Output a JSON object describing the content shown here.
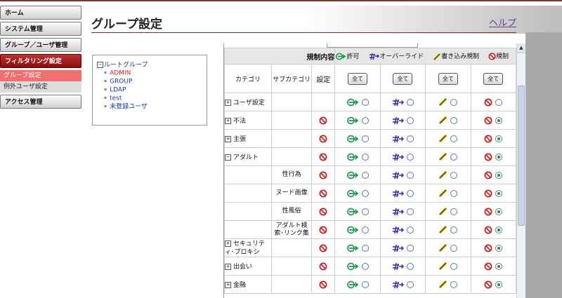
{
  "sidebar": {
    "home": "ホーム",
    "system": "システム管理",
    "group_user": "グループ／ユーザ管理",
    "filtering": "フィルタリング設定",
    "group_settings": "グループ設定",
    "exception_users": "例外ユーザ設定",
    "access": "アクセス管理"
  },
  "header": {
    "title": "グループ設定",
    "help": "ヘルプ"
  },
  "tree": {
    "root": "ルートグループ",
    "items": [
      "ADMIN",
      "GROUP",
      "LDAP",
      "test",
      "未登録ユーザ"
    ]
  },
  "legend": {
    "label": "規制内容",
    "allow": "許可",
    "override": "オーバーライド",
    "write": "書き込み規制",
    "block": "規制"
  },
  "columns": {
    "category": "カテゴリ",
    "subcategory": "サブカテゴリ",
    "setting": "設定",
    "all": "全て"
  },
  "rows": [
    {
      "cat": "ユーザ設定",
      "sub": "",
      "expand": "+",
      "block_icon": false,
      "selected": "none"
    },
    {
      "cat": "不法",
      "sub": "",
      "expand": "+",
      "block_icon": true,
      "selected": "block"
    },
    {
      "cat": "主張",
      "sub": "",
      "expand": "+",
      "block_icon": true,
      "selected": "block"
    },
    {
      "cat": "アダルト",
      "sub": "",
      "expand": "−",
      "block_icon": true,
      "selected": "block"
    },
    {
      "cat": "",
      "sub": "性行為",
      "expand": "",
      "block_icon": true,
      "selected": "block"
    },
    {
      "cat": "",
      "sub": "ヌード画像",
      "expand": "",
      "block_icon": true,
      "selected": "block"
    },
    {
      "cat": "",
      "sub": "性風俗",
      "expand": "",
      "block_icon": true,
      "selected": "block"
    },
    {
      "cat": "",
      "sub": "アダルト検索･リンク集",
      "expand": "",
      "block_icon": true,
      "selected": "block"
    },
    {
      "cat": "セキュリティ･プロキシ",
      "sub": "",
      "expand": "+",
      "block_icon": true,
      "selected": "block"
    },
    {
      "cat": "出会い",
      "sub": "",
      "expand": "+",
      "block_icon": true,
      "selected": "block"
    },
    {
      "cat": "金融",
      "sub": "",
      "expand": "+",
      "block_icon": true,
      "selected": "block"
    }
  ],
  "colors": {
    "accent": "#a01818",
    "allow": "#1f9a4a",
    "override": "#3a2ab0",
    "block": "#d01a1a"
  }
}
